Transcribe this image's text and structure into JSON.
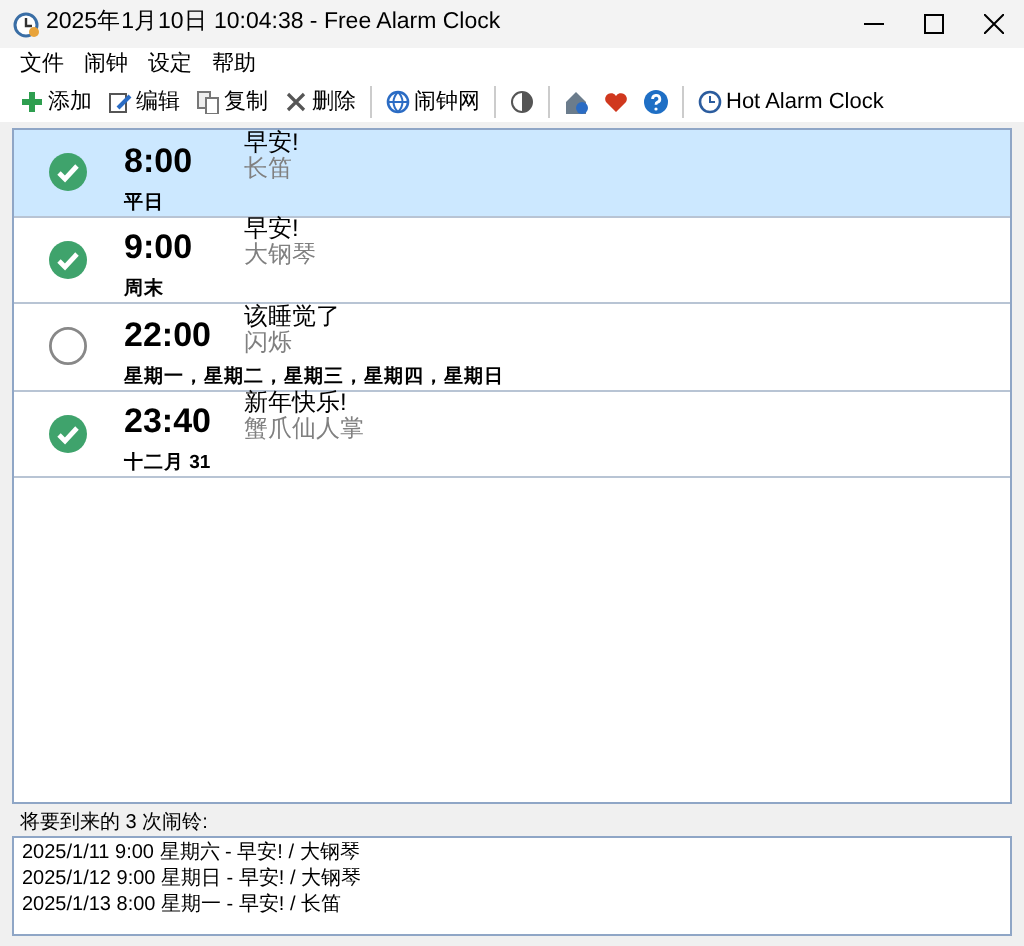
{
  "window": {
    "title": "2025年1月10日 10:04:38 - Free Alarm Clock"
  },
  "menu": [
    "文件",
    "闹钟",
    "设定",
    "帮助"
  ],
  "toolbar": [
    {
      "kind": "button",
      "label": "添加"
    },
    {
      "kind": "button",
      "label": "编辑"
    },
    {
      "kind": "button",
      "label": "复制"
    },
    {
      "kind": "button",
      "label": "删除"
    },
    {
      "kind": "separator"
    },
    {
      "kind": "button",
      "label": "闹钟网"
    },
    {
      "kind": "separator"
    },
    {
      "kind": "icon"
    },
    {
      "kind": "separator"
    },
    {
      "kind": "icon"
    },
    {
      "kind": "icon"
    },
    {
      "kind": "icon"
    },
    {
      "kind": "separator"
    },
    {
      "kind": "button",
      "label": "Hot Alarm Clock"
    }
  ],
  "alarms": [
    {
      "enabled": true,
      "selected": true,
      "time": "8:00",
      "days": "平日",
      "message": "早安!",
      "sound": "长笛"
    },
    {
      "enabled": true,
      "selected": false,
      "time": "9:00",
      "days": "周末",
      "message": "早安!",
      "sound": "大钢琴"
    },
    {
      "enabled": false,
      "selected": false,
      "time": "22:00",
      "days": "星期一，星期二，星期三，星期四，星期日",
      "message": "该睡觉了",
      "sound": "闪烁"
    },
    {
      "enabled": true,
      "selected": false,
      "time": "23:40",
      "days": "十二月 31",
      "message": "新年快乐!",
      "sound": "蟹爪仙人掌"
    }
  ],
  "upcoming": {
    "label": "将要到来的 3 次闹铃:",
    "items": [
      "2025/1/11 9:00 星期六 - 早安! / 大钢琴",
      "2025/1/12 9:00 星期日 - 早安! / 大钢琴",
      "2025/1/13 8:00 星期一 - 早安! / 长笛"
    ]
  }
}
